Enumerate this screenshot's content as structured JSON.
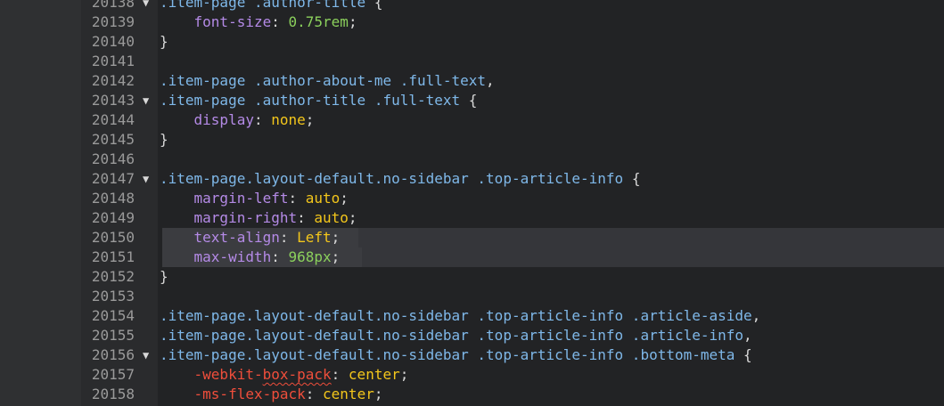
{
  "editor": {
    "theme_colors": {
      "background": "#222325",
      "gutter": "#2a2b2d",
      "selector": "#7fb8e9",
      "property": "#b48ae6",
      "value": "#f3c61b",
      "number": "#8bd05c",
      "vendor_property": "#ef4e3b"
    },
    "lines": [
      {
        "n": "20138",
        "fold": "▼",
        "tokens": [
          {
            "t": ".item-page .author-title ",
            "c": "sel"
          },
          {
            "t": "{",
            "c": "brace"
          }
        ]
      },
      {
        "n": "20139",
        "fold": "",
        "tokens": [
          {
            "t": "    ",
            "c": "brace"
          },
          {
            "t": "font-size",
            "c": "prop"
          },
          {
            "t": ": ",
            "c": "punc"
          },
          {
            "t": "0.75rem",
            "c": "num"
          },
          {
            "t": ";",
            "c": "punc"
          }
        ]
      },
      {
        "n": "20140",
        "fold": "",
        "tokens": [
          {
            "t": "}",
            "c": "brace"
          }
        ]
      },
      {
        "n": "20141",
        "fold": "",
        "tokens": []
      },
      {
        "n": "20142",
        "fold": "",
        "tokens": [
          {
            "t": ".item-page .author-about-me .full-text",
            "c": "sel"
          },
          {
            "t": ",",
            "c": "punc"
          }
        ]
      },
      {
        "n": "20143",
        "fold": "▼",
        "tokens": [
          {
            "t": ".item-page .author-title .full-text ",
            "c": "sel"
          },
          {
            "t": "{",
            "c": "brace"
          }
        ]
      },
      {
        "n": "20144",
        "fold": "",
        "tokens": [
          {
            "t": "    ",
            "c": "brace"
          },
          {
            "t": "display",
            "c": "prop"
          },
          {
            "t": ": ",
            "c": "punc"
          },
          {
            "t": "none",
            "c": "val"
          },
          {
            "t": ";",
            "c": "punc"
          }
        ]
      },
      {
        "n": "20145",
        "fold": "",
        "tokens": [
          {
            "t": "}",
            "c": "brace"
          }
        ]
      },
      {
        "n": "20146",
        "fold": "",
        "tokens": []
      },
      {
        "n": "20147",
        "fold": "▼",
        "tokens": [
          {
            "t": ".item-page.layout-default.no-sidebar .top-article-info ",
            "c": "sel"
          },
          {
            "t": "{",
            "c": "brace"
          }
        ]
      },
      {
        "n": "20148",
        "fold": "",
        "tokens": [
          {
            "t": "    ",
            "c": "brace"
          },
          {
            "t": "margin-left",
            "c": "prop"
          },
          {
            "t": ": ",
            "c": "punc"
          },
          {
            "t": "auto",
            "c": "val"
          },
          {
            "t": ";",
            "c": "punc"
          }
        ]
      },
      {
        "n": "20149",
        "fold": "",
        "tokens": [
          {
            "t": "    ",
            "c": "brace"
          },
          {
            "t": "margin-right",
            "c": "prop"
          },
          {
            "t": ": ",
            "c": "punc"
          },
          {
            "t": "auto",
            "c": "val"
          },
          {
            "t": ";",
            "c": "punc"
          }
        ]
      },
      {
        "n": "20150",
        "fold": "",
        "hl": true,
        "tokens": [
          {
            "t": "    ",
            "c": "brace"
          },
          {
            "t": "text-align",
            "c": "prop"
          },
          {
            "t": ": ",
            "c": "punc"
          },
          {
            "t": "Left",
            "c": "val"
          },
          {
            "t": ";",
            "c": "punc"
          }
        ]
      },
      {
        "n": "20151",
        "fold": "",
        "sel": true,
        "tokens": [
          {
            "t": "    ",
            "c": "brace"
          },
          {
            "t": "max-width",
            "c": "prop"
          },
          {
            "t": ": ",
            "c": "punc"
          },
          {
            "t": "968px",
            "c": "num"
          },
          {
            "t": ";",
            "c": "punc"
          }
        ]
      },
      {
        "n": "20152",
        "fold": "",
        "tokens": [
          {
            "t": "}",
            "c": "brace"
          }
        ]
      },
      {
        "n": "20153",
        "fold": "",
        "tokens": []
      },
      {
        "n": "20154",
        "fold": "",
        "tokens": [
          {
            "t": ".item-page.layout-default.no-sidebar .top-article-info .article-aside",
            "c": "sel"
          },
          {
            "t": ",",
            "c": "punc"
          }
        ]
      },
      {
        "n": "20155",
        "fold": "",
        "tokens": [
          {
            "t": ".item-page.layout-default.no-sidebar .top-article-info .article-info",
            "c": "sel"
          },
          {
            "t": ",",
            "c": "punc"
          }
        ]
      },
      {
        "n": "20156",
        "fold": "▼",
        "tokens": [
          {
            "t": ".item-page.layout-default.no-sidebar .top-article-info .bottom-meta ",
            "c": "sel"
          },
          {
            "t": "{",
            "c": "brace"
          }
        ]
      },
      {
        "n": "20157",
        "fold": "",
        "tokens": [
          {
            "t": "    ",
            "c": "brace"
          },
          {
            "t": "-webkit-",
            "c": "vendor"
          },
          {
            "t": "box-pack",
            "c": "vendor squiggle"
          },
          {
            "t": ": ",
            "c": "punc"
          },
          {
            "t": "center",
            "c": "val"
          },
          {
            "t": ";",
            "c": "punc"
          }
        ]
      },
      {
        "n": "20158",
        "fold": "",
        "tokens": [
          {
            "t": "    ",
            "c": "brace"
          },
          {
            "t": "-ms-flex-pack",
            "c": "vendor"
          },
          {
            "t": ": ",
            "c": "punc"
          },
          {
            "t": "center",
            "c": "val"
          },
          {
            "t": ";",
            "c": "punc"
          }
        ]
      }
    ]
  }
}
